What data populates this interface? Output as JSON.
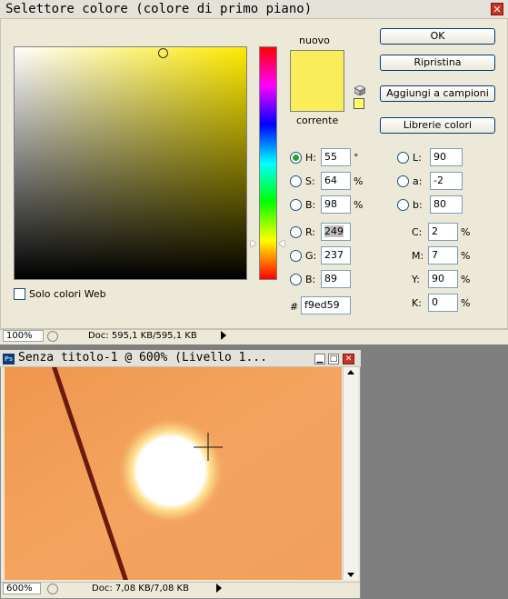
{
  "picker": {
    "title": "Selettore colore (colore di primo piano)",
    "close_label": "✕",
    "nuovo_label": "nuovo",
    "corrente_label": "corrente",
    "new_color": "#f9ed59",
    "current_color": "#f9ed59",
    "websafe_color": "#ffff66",
    "buttons": {
      "ok": "OK",
      "reset": "Ripristina",
      "add_swatches": "Aggiungi a campioni",
      "libraries": "Librerie colori"
    },
    "hsb": {
      "h": {
        "label": "H:",
        "value": "55",
        "unit": "°"
      },
      "s": {
        "label": "S:",
        "value": "64",
        "unit": "%"
      },
      "b": {
        "label": "B:",
        "value": "98",
        "unit": "%"
      }
    },
    "rgb": {
      "r": {
        "label": "R:",
        "value": "249"
      },
      "g": {
        "label": "G:",
        "value": "237"
      },
      "b": {
        "label": "B:",
        "value": "89"
      }
    },
    "lab": {
      "l": {
        "label": "L:",
        "value": "90"
      },
      "a": {
        "label": "a:",
        "value": "-2"
      },
      "b": {
        "label": "b:",
        "value": "80"
      }
    },
    "cmyk": {
      "c": {
        "label": "C:",
        "value": "2",
        "unit": "%"
      },
      "m": {
        "label": "M:",
        "value": "7",
        "unit": "%"
      },
      "y": {
        "label": "Y:",
        "value": "90",
        "unit": "%"
      },
      "k": {
        "label": "K:",
        "value": "0",
        "unit": "%"
      }
    },
    "hex": {
      "label": "#",
      "value": "f9ed59"
    },
    "web_only_label": "Solo colori Web"
  },
  "picker_status": {
    "zoom": "100%",
    "doc": "Doc: 595,1 KB/595,1 KB"
  },
  "document": {
    "title": "Senza titolo-1 @ 600% (Livello 1...",
    "ps_icon": "Ps",
    "zoom": "600%",
    "doc": "Doc: 7,08 KB/7,08 KB"
  }
}
